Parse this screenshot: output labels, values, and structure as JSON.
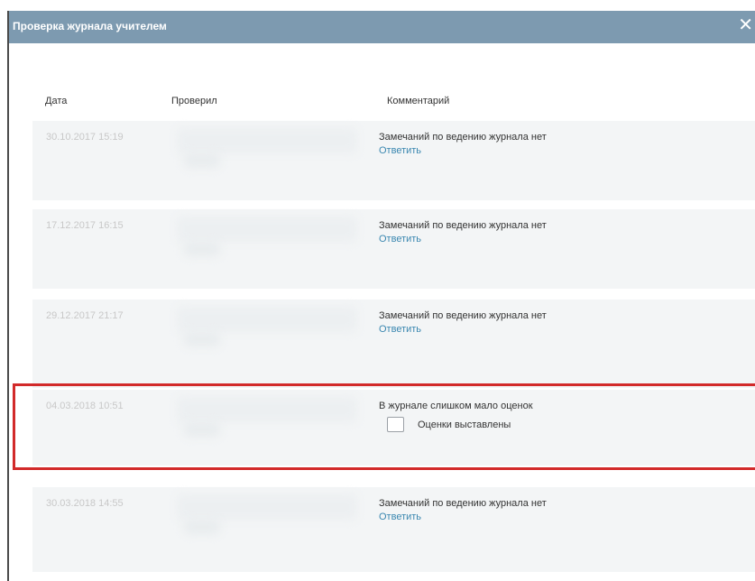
{
  "dialog": {
    "title": "Проверка журнала учителем",
    "close_glyph": "✕"
  },
  "columns": {
    "date": "Дата",
    "checked_by": "Проверил",
    "comment": "Комментарий"
  },
  "rows": [
    {
      "date": "30.10.2017 15:19",
      "comment": "Замечаний по ведению журнала нет",
      "reply": "Ответить"
    },
    {
      "date": "17.12.2017 16:15",
      "comment": "Замечаний по ведению журнала нет",
      "reply": "Ответить"
    },
    {
      "date": "29.12.2017 21:17",
      "comment": "Замечаний по ведению журнала нет",
      "reply": "Ответить"
    },
    {
      "date": "04.03.2018 10:51",
      "comment": "В журнале слишком мало оценок",
      "checkbox_label": "Оценки выставлены",
      "checked": false
    },
    {
      "date": "30.03.2018 14:55",
      "comment": "Замечаний по ведению журнала нет",
      "reply": "Ответить"
    }
  ],
  "colors": {
    "titlebar": "#7d9ab0",
    "row_background": "#f3f5f6",
    "link": "#3a87b0",
    "highlight": "#d22a2a"
  }
}
